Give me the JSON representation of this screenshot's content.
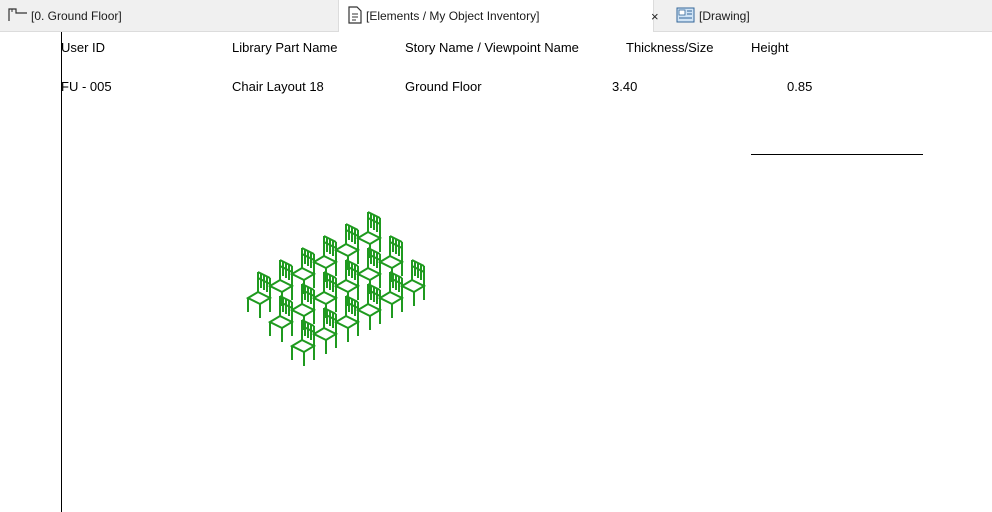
{
  "tabs": [
    {
      "label": "[0. Ground Floor]",
      "icon": "floor-plan-icon"
    },
    {
      "label": "[Elements /  My Object Inventory]",
      "icon": "document-icon",
      "active": true
    },
    {
      "label": "[Drawing]",
      "icon": "drawing-icon"
    }
  ],
  "close_label": "×",
  "table": {
    "headers": [
      "User ID",
      "Library Part Name",
      "Story Name / Viewpoint Name",
      "Thickness/Size",
      "Height"
    ],
    "row": [
      "FU - 005",
      "Chair Layout 18",
      "Ground Floor",
      "3.40",
      "0.85"
    ]
  },
  "preview": {
    "name": "chair-layout-preview",
    "color": "#1f9a1f",
    "rows": 6,
    "cols": 3
  }
}
